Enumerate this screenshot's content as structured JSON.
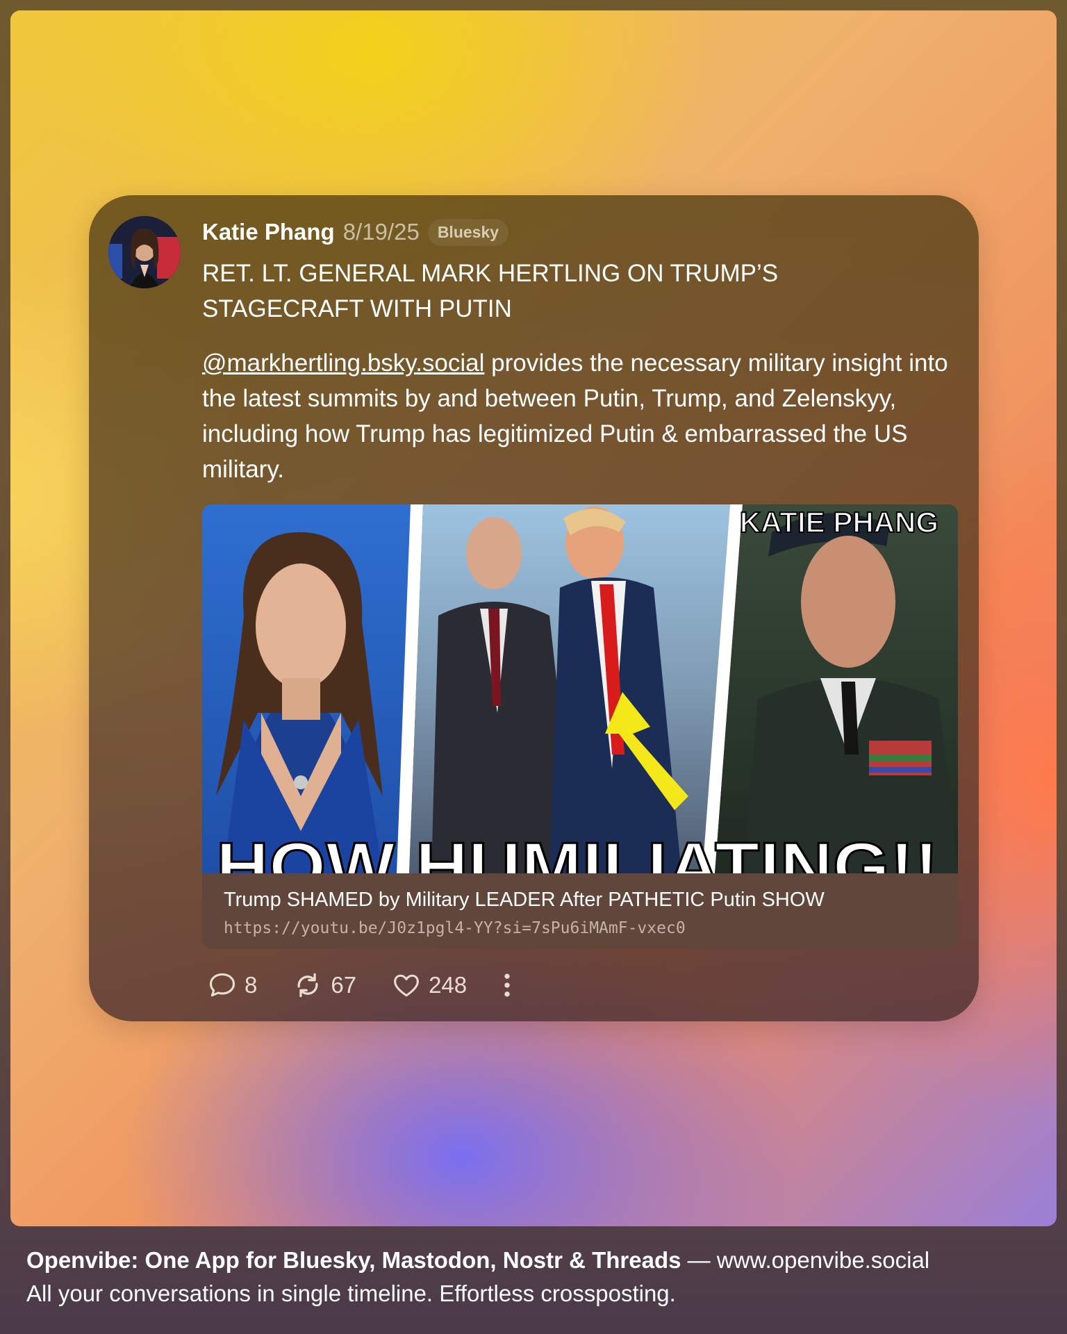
{
  "post": {
    "author": "Katie Phang",
    "date": "8/19/25",
    "network_badge": "Bluesky",
    "title": "RET. LT. GENERAL MARK HERTLING ON TRUMP’S STAGECRAFT WITH PUTIN",
    "mention": "@markhertling.bsky.social",
    "body": " provides the necessary military insight into the latest summits by and between Putin, Trump, and Zelenskyy, including how Trump has legitimized Putin & embarrassed the US military."
  },
  "link_card": {
    "thumbnail_overlay_brand": "KATIE PHANG",
    "thumbnail_caption": "HOW HUMILIATING!!",
    "title": "Trump SHAMED by Military LEADER After PATHETIC Putin SHOW",
    "url": "https://youtu.be/J0z1pgl4-YY?si=7sPu6iMAmF-vxec0"
  },
  "actions": {
    "replies": "8",
    "reposts": "67",
    "likes": "248"
  },
  "footer": {
    "headline": "Openvibe: One App for Bluesky, Mastodon, Nostr & Threads",
    "separator": " — ",
    "site": "www.openvibe.social",
    "tagline": "All your conversations in single timeline. Effortless crossposting."
  },
  "icons": [
    "reply-icon",
    "repost-icon",
    "like-icon",
    "more-icon"
  ],
  "colors": {
    "caption_text": "#ffffff",
    "arrow": "#f4e81a",
    "tie": "#d81c1c"
  }
}
